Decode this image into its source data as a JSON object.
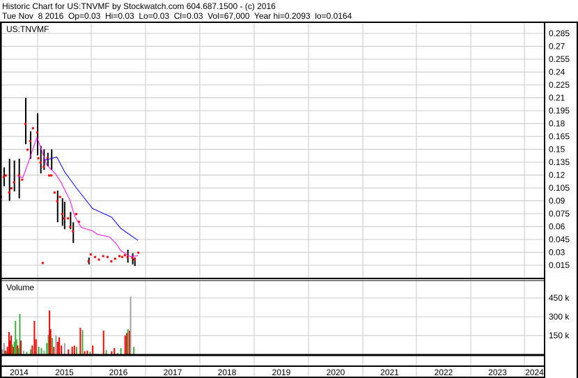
{
  "header": {
    "title": "Historic Chart for US:TNVMF by Stockwatch.com 604.687.1500 - (c) 2016",
    "quote": "Tue Nov  8 2016  Op=0.03  Hi=0.03  Lo=0.03  Cl=0.03  Vol=67,000  Year hi=0.2093  lo=0.0164"
  },
  "chart_data": {
    "type": "line",
    "symbol_label": "US:TNVMF",
    "volume_label": "Volume",
    "price_ticks": [
      "0.285",
      "0.27",
      "0.255",
      "0.24",
      "0.225",
      "0.21",
      "0.195",
      "0.18",
      "0.165",
      "0.15",
      "0.135",
      "0.12",
      "0.105",
      "0.09",
      "0.075",
      "0.06",
      "0.045",
      "0.03",
      "0.015"
    ],
    "ylim": [
      0.006,
      0.298
    ],
    "volume_ticks": [
      "450 k",
      "300 k",
      "150 k"
    ],
    "volume_tick_values": [
      450,
      300,
      150
    ],
    "volume_ylim": [
      0,
      560
    ],
    "years": [
      "2014",
      "2015",
      "2016",
      "2017",
      "2018",
      "2019",
      "2020",
      "2021",
      "2022",
      "2023",
      "2024"
    ],
    "xlim": [
      2014.3,
      2024.4
    ],
    "colors": {
      "bar": "#000000",
      "close": "#ff0000",
      "ma_long": "#0000ff",
      "ma_short": "#ff00ff",
      "vol_up": "#40b040",
      "vol_down": "#ff0000",
      "vol_flat": "#a0a0a0",
      "grid": "#c8c8c8"
    },
    "price_bars": [
      [
        2014.36,
        0.129,
        0.107,
        0.118
      ],
      [
        2014.46,
        0.139,
        0.09,
        0.1
      ],
      [
        2014.55,
        0.137,
        0.101,
        0.112
      ],
      [
        2014.64,
        0.139,
        0.093,
        0.12
      ],
      [
        2014.76,
        0.21,
        0.156,
        0.18
      ],
      [
        2014.85,
        0.171,
        0.139,
        0.16
      ],
      [
        2014.98,
        0.192,
        0.143,
        0.17
      ],
      [
        2015.04,
        0.154,
        0.122,
        0.135
      ],
      [
        2015.1,
        0.15,
        0.126,
        0.13
      ],
      [
        2015.17,
        0.146,
        0.13,
        0.14
      ],
      [
        2015.24,
        0.15,
        0.126,
        0.12
      ],
      [
        2015.35,
        0.102,
        0.065,
        0.09
      ],
      [
        2015.44,
        0.093,
        0.061,
        0.075
      ],
      [
        2015.48,
        0.089,
        0.057,
        0.07
      ],
      [
        2015.59,
        0.077,
        0.057,
        0.06
      ],
      [
        2015.64,
        0.065,
        0.041,
        0.055
      ],
      [
        2015.93,
        0.024,
        0.016,
        0.02
      ],
      [
        2016.65,
        0.033,
        0.018,
        0.025
      ],
      [
        2016.74,
        0.029,
        0.016,
        0.024
      ],
      [
        2016.78,
        0.024,
        0.014,
        0.022
      ]
    ],
    "close_points": [
      [
        2014.31,
        0.095,
        0.0
      ],
      [
        2014.4,
        0.12
      ],
      [
        2014.5,
        0.105
      ],
      [
        2014.7,
        0.115
      ],
      [
        2014.8,
        0.15
      ],
      [
        2014.9,
        0.175
      ],
      [
        2015.0,
        0.14
      ],
      [
        2015.08,
        0.018
      ],
      [
        2015.2,
        0.12
      ],
      [
        2015.3,
        0.1
      ],
      [
        2015.4,
        0.095
      ],
      [
        2015.55,
        0.07
      ],
      [
        2015.7,
        0.075
      ],
      [
        2015.75,
        0.066
      ],
      [
        2015.97,
        0.028
      ],
      [
        2016.05,
        0.025
      ],
      [
        2016.12,
        0.022
      ],
      [
        2016.2,
        0.026
      ],
      [
        2016.28,
        0.025
      ],
      [
        2016.35,
        0.02
      ],
      [
        2016.42,
        0.023
      ],
      [
        2016.5,
        0.026
      ],
      [
        2016.55,
        0.025
      ],
      [
        2016.6,
        0.027
      ],
      [
        2016.85,
        0.03
      ]
    ],
    "series": [
      {
        "name": "Moving average (long)",
        "points": [
          [
            2015.1,
            0.137
          ],
          [
            2015.35,
            0.141
          ],
          [
            2015.49,
            0.124
          ],
          [
            2015.71,
            0.105
          ],
          [
            2016.01,
            0.081
          ],
          [
            2016.36,
            0.071
          ],
          [
            2016.53,
            0.058
          ],
          [
            2016.71,
            0.05
          ],
          [
            2016.85,
            0.044
          ]
        ]
      },
      {
        "name": "Moving average (short)",
        "points": [
          [
            2014.62,
            0.119
          ],
          [
            2014.72,
            0.117
          ],
          [
            2014.85,
            0.14
          ],
          [
            2014.98,
            0.164
          ],
          [
            2015.04,
            0.154
          ],
          [
            2015.16,
            0.132
          ],
          [
            2015.33,
            0.121
          ],
          [
            2015.43,
            0.111
          ],
          [
            2015.59,
            0.091
          ],
          [
            2015.68,
            0.072
          ],
          [
            2015.8,
            0.059
          ],
          [
            2016.01,
            0.055
          ],
          [
            2016.1,
            0.051
          ],
          [
            2016.32,
            0.048
          ],
          [
            2016.45,
            0.04
          ],
          [
            2016.53,
            0.032
          ],
          [
            2016.71,
            0.025
          ],
          [
            2016.85,
            0.026
          ]
        ]
      }
    ],
    "volume_bars": [
      [
        2014.33,
        40,
        "flat"
      ],
      [
        2014.36,
        90,
        "flat"
      ],
      [
        2014.38,
        30,
        "down"
      ],
      [
        2014.4,
        25,
        "up"
      ],
      [
        2014.42,
        60,
        "down"
      ],
      [
        2014.45,
        178,
        "down"
      ],
      [
        2014.47,
        110,
        "down"
      ],
      [
        2014.49,
        150,
        "down"
      ],
      [
        2014.51,
        80,
        "up"
      ],
      [
        2014.53,
        60,
        "down"
      ],
      [
        2014.55,
        100,
        "up"
      ],
      [
        2014.57,
        267,
        "up"
      ],
      [
        2014.59,
        120,
        "up"
      ],
      [
        2014.61,
        70,
        "down"
      ],
      [
        2014.63,
        50,
        "up"
      ],
      [
        2014.65,
        322,
        "up"
      ],
      [
        2014.67,
        110,
        "down"
      ],
      [
        2014.72,
        30,
        "flat"
      ],
      [
        2014.78,
        20,
        "up"
      ],
      [
        2014.85,
        40,
        "up"
      ],
      [
        2014.88,
        70,
        "down"
      ],
      [
        2014.92,
        267,
        "down"
      ],
      [
        2014.95,
        120,
        "down"
      ],
      [
        2015.0,
        60,
        "up"
      ],
      [
        2015.05,
        50,
        "up"
      ],
      [
        2015.1,
        30,
        "flat"
      ],
      [
        2015.15,
        90,
        "up"
      ],
      [
        2015.18,
        155,
        "up"
      ],
      [
        2015.2,
        350,
        "down"
      ],
      [
        2015.22,
        200,
        "down"
      ],
      [
        2015.25,
        130,
        "up"
      ],
      [
        2015.28,
        60,
        "down"
      ],
      [
        2015.32,
        150,
        "flat"
      ],
      [
        2015.35,
        100,
        "down"
      ],
      [
        2015.38,
        135,
        "down"
      ],
      [
        2015.42,
        70,
        "down"
      ],
      [
        2015.48,
        90,
        "flat"
      ],
      [
        2015.55,
        40,
        "down"
      ],
      [
        2015.62,
        60,
        "down"
      ],
      [
        2015.66,
        70,
        "down"
      ],
      [
        2015.7,
        60,
        "up"
      ],
      [
        2015.77,
        211,
        "down"
      ],
      [
        2015.81,
        194,
        "up"
      ],
      [
        2015.85,
        25,
        "down"
      ],
      [
        2015.9,
        30,
        "down"
      ],
      [
        2015.95,
        20,
        "up"
      ],
      [
        2016.0,
        70,
        "down"
      ],
      [
        2016.05,
        5,
        "flat"
      ],
      [
        2016.2,
        189,
        "down"
      ],
      [
        2016.25,
        35,
        "up"
      ],
      [
        2016.35,
        25,
        "down"
      ],
      [
        2016.4,
        50,
        "down"
      ],
      [
        2016.46,
        10,
        "up"
      ],
      [
        2016.52,
        50,
        "up"
      ],
      [
        2016.6,
        150,
        "down"
      ],
      [
        2016.63,
        170,
        "down"
      ],
      [
        2016.65,
        200,
        "up"
      ],
      [
        2016.68,
        189,
        "down"
      ],
      [
        2016.7,
        461,
        "flat"
      ],
      [
        2016.76,
        60,
        "up"
      ]
    ]
  }
}
